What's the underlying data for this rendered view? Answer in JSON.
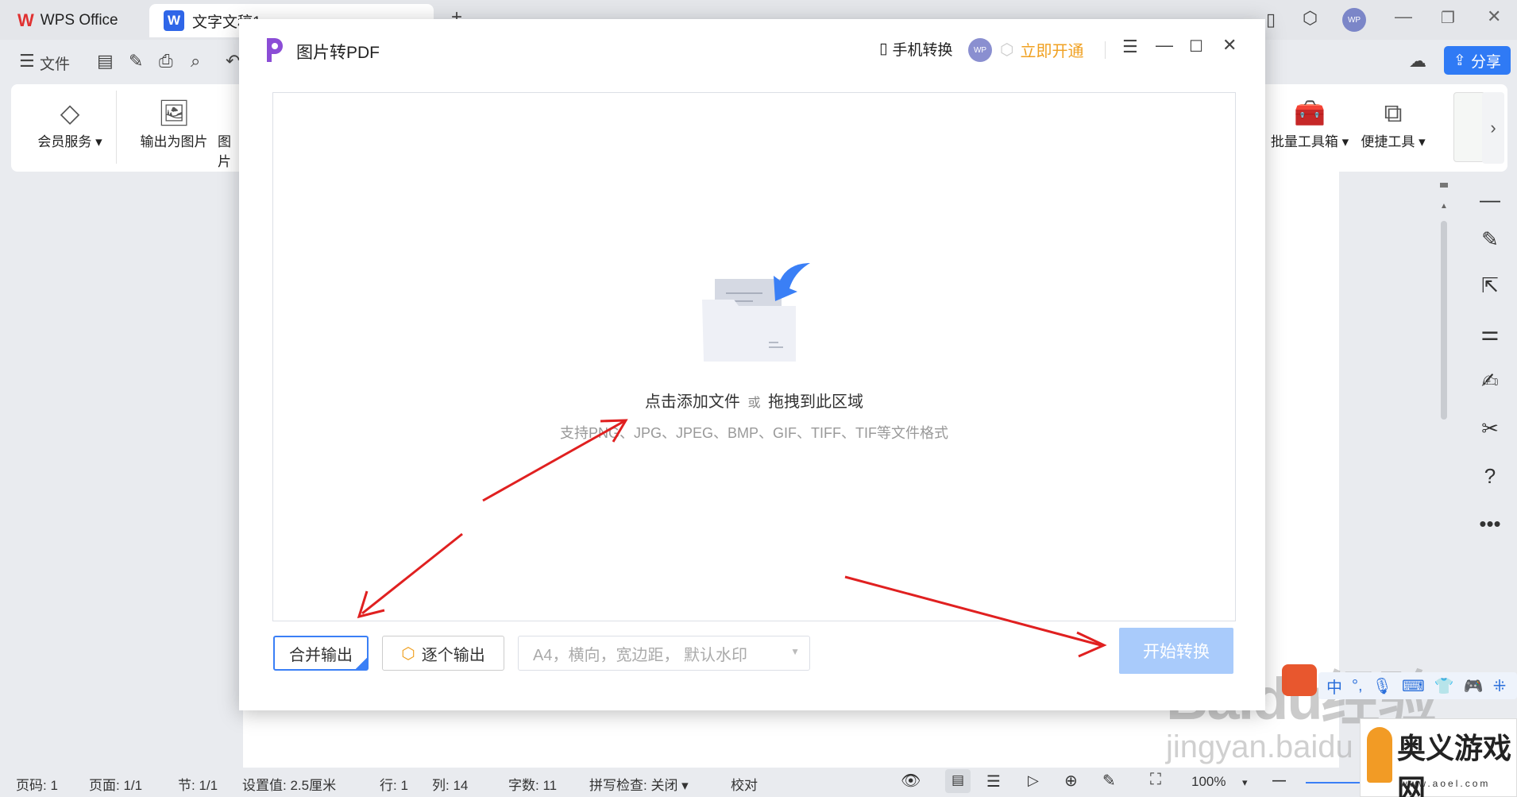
{
  "titlebar": {
    "tab_wps": "WPS Office",
    "tab_doc": "文字文稿1",
    "avatar": "WP"
  },
  "menu": {
    "file": "文件"
  },
  "ribbon": {
    "member": "会员服务",
    "export_image": "输出为图片",
    "image_partial": "图片",
    "batch_tools": "批量工具箱",
    "quick_tools": "便捷工具"
  },
  "share_label": "分享",
  "dialog": {
    "title": "图片转PDF",
    "phone_convert": "手机转换",
    "avatar": "WP",
    "activate": "立即开通",
    "drop_main": "点击添加文件",
    "drop_or": "或",
    "drop_drag": "拖拽到此区域",
    "drop_formats": "支持PNG、JPG、JPEG、BMP、GIF、TIFF、TIF等文件格式",
    "merge_output": "合并输出",
    "single_output": "逐个输出",
    "page_settings": "A4，横向，宽边距，  默认水印",
    "start": "开始转换"
  },
  "statusbar": {
    "page_code": "页码: 1",
    "page": "页面: 1/1",
    "section": "节: 1/1",
    "setting": "设置值: 2.5厘米",
    "row": "行: 1",
    "col": "列: 14",
    "words": "字数: 11",
    "spell": "拼写检查: 关闭",
    "proof": "校对",
    "zoom": "100%"
  },
  "watermark": {
    "baidu": "Baidu经验",
    "jingyan": "jingyan.baidu",
    "aoyi": "奥义游戏网",
    "aoyi_url": "www.aoel.com"
  },
  "colors": {
    "accent": "#3a7ff6",
    "start_disabled": "#a9cbfb",
    "activate": "#f0a020",
    "annotation_arrow": "#e02020"
  }
}
